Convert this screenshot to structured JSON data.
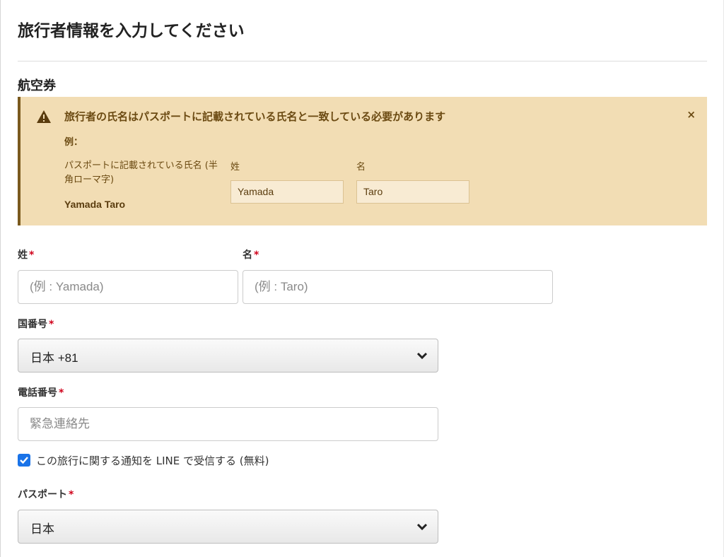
{
  "page": {
    "title": "旅行者情報を入力してください",
    "section": "航空券"
  },
  "alert": {
    "icon": "warning-icon",
    "title": "旅行者の氏名はパスポートに記載されている氏名と一致している必要があります",
    "close": "×",
    "example_label": "例：",
    "example_desc": "パスポートに記載されている氏名 (半角ローマ字)",
    "example_name": "Yamada Taro",
    "surname_label": "姓",
    "given_label": "名",
    "surname_value": "Yamada",
    "given_value": "Taro",
    "bg_color": "#f2ddb4",
    "accent_color": "#7a5a1e"
  },
  "form": {
    "required_mark": "*",
    "surname": {
      "label": "姓",
      "placeholder": "(例 : Yamada)"
    },
    "given": {
      "label": "名",
      "placeholder": "(例 : Taro)"
    },
    "country_code": {
      "label": "国番号",
      "value": "日本 +81"
    },
    "phone": {
      "label": "電話番号",
      "placeholder": "緊急連絡先"
    },
    "line_opt_in": {
      "label": "この旅行に関する通知を LINE で受信する (無料)",
      "checked": true
    },
    "passport": {
      "label": "パスポート",
      "value": "日本"
    }
  },
  "colors": {
    "required": "#d0021b",
    "checkbox": "#1a73e8"
  }
}
